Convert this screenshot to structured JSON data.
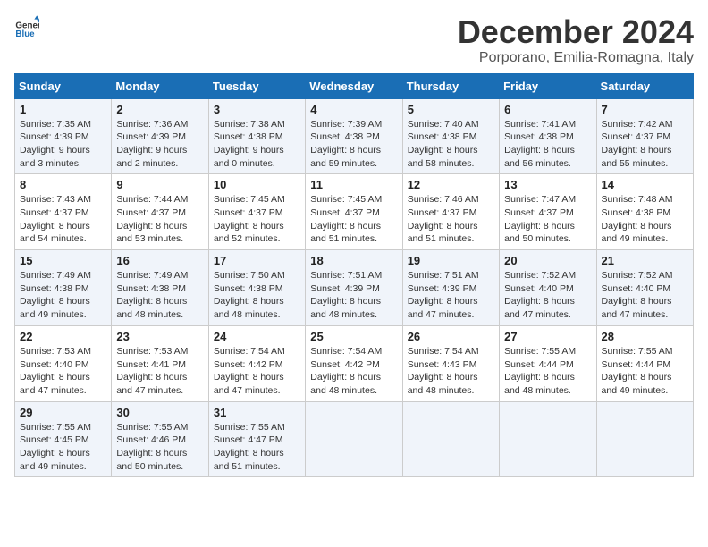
{
  "logo": {
    "text_general": "General",
    "text_blue": "Blue"
  },
  "header": {
    "month_title": "December 2024",
    "subtitle": "Porporano, Emilia-Romagna, Italy"
  },
  "weekdays": [
    "Sunday",
    "Monday",
    "Tuesday",
    "Wednesday",
    "Thursday",
    "Friday",
    "Saturday"
  ],
  "weeks": [
    [
      {
        "day": "1",
        "sunrise": "7:35 AM",
        "sunset": "4:39 PM",
        "daylight": "9 hours and 3 minutes."
      },
      {
        "day": "2",
        "sunrise": "7:36 AM",
        "sunset": "4:39 PM",
        "daylight": "9 hours and 2 minutes."
      },
      {
        "day": "3",
        "sunrise": "7:38 AM",
        "sunset": "4:38 PM",
        "daylight": "9 hours and 0 minutes."
      },
      {
        "day": "4",
        "sunrise": "7:39 AM",
        "sunset": "4:38 PM",
        "daylight": "8 hours and 59 minutes."
      },
      {
        "day": "5",
        "sunrise": "7:40 AM",
        "sunset": "4:38 PM",
        "daylight": "8 hours and 58 minutes."
      },
      {
        "day": "6",
        "sunrise": "7:41 AM",
        "sunset": "4:38 PM",
        "daylight": "8 hours and 56 minutes."
      },
      {
        "day": "7",
        "sunrise": "7:42 AM",
        "sunset": "4:37 PM",
        "daylight": "8 hours and 55 minutes."
      }
    ],
    [
      {
        "day": "8",
        "sunrise": "7:43 AM",
        "sunset": "4:37 PM",
        "daylight": "8 hours and 54 minutes."
      },
      {
        "day": "9",
        "sunrise": "7:44 AM",
        "sunset": "4:37 PM",
        "daylight": "8 hours and 53 minutes."
      },
      {
        "day": "10",
        "sunrise": "7:45 AM",
        "sunset": "4:37 PM",
        "daylight": "8 hours and 52 minutes."
      },
      {
        "day": "11",
        "sunrise": "7:45 AM",
        "sunset": "4:37 PM",
        "daylight": "8 hours and 51 minutes."
      },
      {
        "day": "12",
        "sunrise": "7:46 AM",
        "sunset": "4:37 PM",
        "daylight": "8 hours and 51 minutes."
      },
      {
        "day": "13",
        "sunrise": "7:47 AM",
        "sunset": "4:37 PM",
        "daylight": "8 hours and 50 minutes."
      },
      {
        "day": "14",
        "sunrise": "7:48 AM",
        "sunset": "4:38 PM",
        "daylight": "8 hours and 49 minutes."
      }
    ],
    [
      {
        "day": "15",
        "sunrise": "7:49 AM",
        "sunset": "4:38 PM",
        "daylight": "8 hours and 49 minutes."
      },
      {
        "day": "16",
        "sunrise": "7:49 AM",
        "sunset": "4:38 PM",
        "daylight": "8 hours and 48 minutes."
      },
      {
        "day": "17",
        "sunrise": "7:50 AM",
        "sunset": "4:38 PM",
        "daylight": "8 hours and 48 minutes."
      },
      {
        "day": "18",
        "sunrise": "7:51 AM",
        "sunset": "4:39 PM",
        "daylight": "8 hours and 48 minutes."
      },
      {
        "day": "19",
        "sunrise": "7:51 AM",
        "sunset": "4:39 PM",
        "daylight": "8 hours and 47 minutes."
      },
      {
        "day": "20",
        "sunrise": "7:52 AM",
        "sunset": "4:40 PM",
        "daylight": "8 hours and 47 minutes."
      },
      {
        "day": "21",
        "sunrise": "7:52 AM",
        "sunset": "4:40 PM",
        "daylight": "8 hours and 47 minutes."
      }
    ],
    [
      {
        "day": "22",
        "sunrise": "7:53 AM",
        "sunset": "4:40 PM",
        "daylight": "8 hours and 47 minutes."
      },
      {
        "day": "23",
        "sunrise": "7:53 AM",
        "sunset": "4:41 PM",
        "daylight": "8 hours and 47 minutes."
      },
      {
        "day": "24",
        "sunrise": "7:54 AM",
        "sunset": "4:42 PM",
        "daylight": "8 hours and 47 minutes."
      },
      {
        "day": "25",
        "sunrise": "7:54 AM",
        "sunset": "4:42 PM",
        "daylight": "8 hours and 48 minutes."
      },
      {
        "day": "26",
        "sunrise": "7:54 AM",
        "sunset": "4:43 PM",
        "daylight": "8 hours and 48 minutes."
      },
      {
        "day": "27",
        "sunrise": "7:55 AM",
        "sunset": "4:44 PM",
        "daylight": "8 hours and 48 minutes."
      },
      {
        "day": "28",
        "sunrise": "7:55 AM",
        "sunset": "4:44 PM",
        "daylight": "8 hours and 49 minutes."
      }
    ],
    [
      {
        "day": "29",
        "sunrise": "7:55 AM",
        "sunset": "4:45 PM",
        "daylight": "8 hours and 49 minutes."
      },
      {
        "day": "30",
        "sunrise": "7:55 AM",
        "sunset": "4:46 PM",
        "daylight": "8 hours and 50 minutes."
      },
      {
        "day": "31",
        "sunrise": "7:55 AM",
        "sunset": "4:47 PM",
        "daylight": "8 hours and 51 minutes."
      },
      null,
      null,
      null,
      null
    ]
  ],
  "labels": {
    "sunrise": "Sunrise:",
    "sunset": "Sunset:",
    "daylight": "Daylight:"
  }
}
